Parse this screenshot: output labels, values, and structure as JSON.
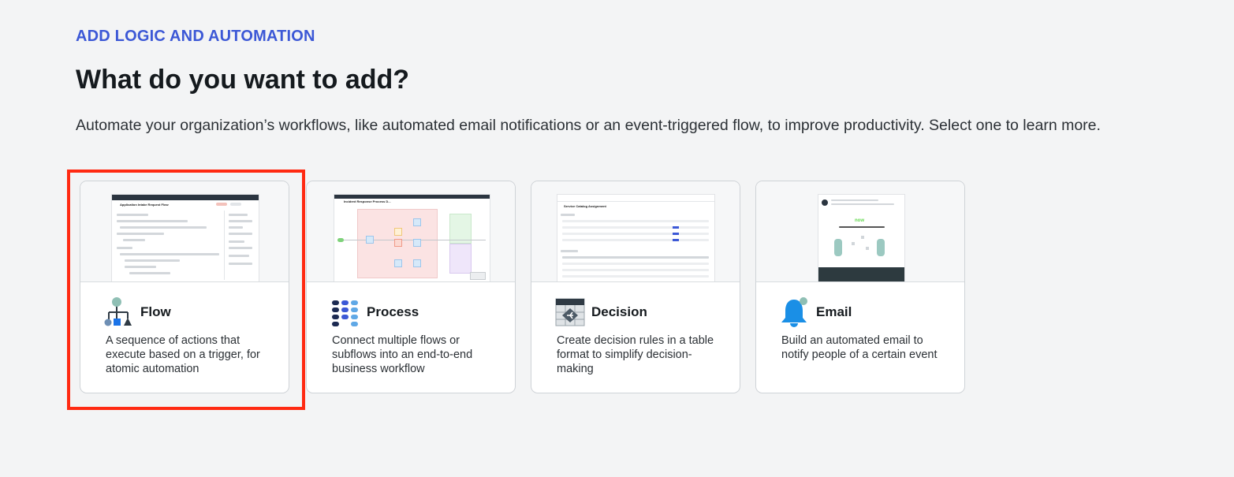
{
  "header": {
    "eyebrow": "ADD LOGIC AND AUTOMATION",
    "title": "What do you want to add?",
    "subtitle": "Automate your organization’s workflows, like automated email notifications or an event-triggered flow, to improve productivity. Select one to learn more."
  },
  "cards": [
    {
      "key": "flow",
      "icon": "flow-icon",
      "label": "Flow",
      "description": "A sequence of actions that execute based on a trigger, for atomic automation",
      "thumbnail_title": "Application Intake Request Flow",
      "selected": true
    },
    {
      "key": "process",
      "icon": "process-icon",
      "label": "Process",
      "description": "Connect multiple flows or subflows into an end-to-end business workflow",
      "thumbnail_title": "Incident Response Process D..."
    },
    {
      "key": "decision",
      "icon": "decision-icon",
      "label": "Decision",
      "description": "Create decision rules in a table format to simplify decision-making",
      "thumbnail_title": "Service Catalog Assignment"
    },
    {
      "key": "email",
      "icon": "email-icon",
      "label": "Email",
      "description": "Build an automated email to notify people of a certain event",
      "thumbnail_title": "now"
    }
  ],
  "colors": {
    "accent": "#3c58d6",
    "selection_outline": "#ff2a12",
    "icon_blue": "#1a73e8",
    "icon_teal": "#6aa69a",
    "icon_dark": "#2f3a44"
  }
}
